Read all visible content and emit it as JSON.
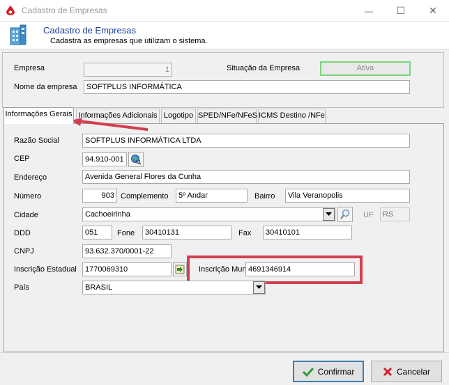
{
  "window": {
    "title": "Cadastro de Empresas",
    "minimize": "—",
    "maximize": "☐",
    "close": "✕"
  },
  "header": {
    "title": "Cadastro de Empresas",
    "subtitle": "Cadastra as empresas que utilizam o sistema."
  },
  "top_panel": {
    "empresa_label": "Empresa",
    "empresa_value": "1",
    "situacao_label": "Situação da Empresa",
    "situacao_value": "Ativa",
    "nome_label": "Nome da empresa",
    "nome_value": "SOFTPLUS INFORMÁTICA"
  },
  "tabs": [
    {
      "label": "Informações Gerais",
      "active": true
    },
    {
      "label": "Informações Adicionais",
      "active": false
    },
    {
      "label": "Logotipo",
      "active": false
    },
    {
      "label": "SPED/NFe/NFeS",
      "active": false
    },
    {
      "label": "ICMS Destino /NFe",
      "active": false
    }
  ],
  "form": {
    "razao_label": "Razão Social",
    "razao_value": "SOFTPLUS INFORMÁTICA LTDA",
    "cep_label": "CEP",
    "cep_value": "94.910-001",
    "endereco_label": "Endereço",
    "endereco_value": "Avenida General Flores da Cunha",
    "numero_label": "Número",
    "numero_value": "903",
    "complemento_label": "Complemento",
    "complemento_value": "5º Andar",
    "bairro_label": "Bairro",
    "bairro_value": "Vila Veranopolis",
    "cidade_label": "Cidade",
    "cidade_value": "Cachoeirinha",
    "uf_label": "UF",
    "uf_value": "RS",
    "ddd_label": "DDD",
    "ddd_value": "051",
    "fone_label": "Fone",
    "fone_value": "30410131",
    "fax_label": "Fax",
    "fax_value": "30410101",
    "cnpj_label": "CNPJ",
    "cnpj_value": "93.632.370/0001-22",
    "ie_label": "Inscrição Estadual",
    "ie_value": "1770069310",
    "im_label": "Inscrição Municipal",
    "im_value": "4691346914",
    "pais_label": "País",
    "pais_value": "BRASIL"
  },
  "buttons": {
    "confirm_label": "Confirmar",
    "cancel_label": "Cancelar"
  },
  "colors": {
    "header_title": "#1a3e9c",
    "highlight": "#d23f4f",
    "status_border": "#7bd67b",
    "confirm_border": "#3c7fb1"
  },
  "icons": [
    "app-drop-icon",
    "building-icon",
    "globe-search-icon",
    "magnifier-icon",
    "refresh-icon",
    "check-icon",
    "x-icon",
    "dropdown-arrow-icon"
  ]
}
